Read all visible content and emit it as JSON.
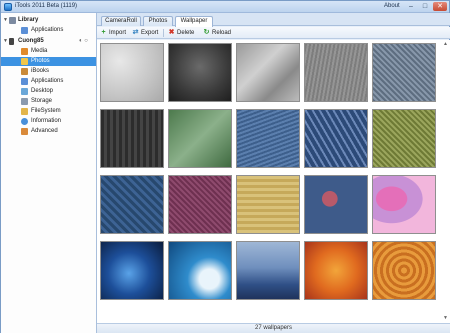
{
  "window": {
    "title": "iTools 2011 Beta (1119)",
    "about_label": "About",
    "min_glyph": "–",
    "max_glyph": "□",
    "close_glyph": "✕"
  },
  "sidebar": {
    "items": [
      {
        "label": "Library",
        "icon": "library-icon"
      },
      {
        "label": "Applications",
        "icon": "applications-icon"
      },
      {
        "label": "Cuong85",
        "icon": "iphone-icon",
        "controls": "◐ ○"
      },
      {
        "label": "Media",
        "icon": "media-icon"
      },
      {
        "label": "Photos",
        "icon": "photos-icon",
        "selected": true
      },
      {
        "label": "iBooks",
        "icon": "ibooks-icon"
      },
      {
        "label": "Applications",
        "icon": "applications-icon"
      },
      {
        "label": "Desktop",
        "icon": "desktop-icon"
      },
      {
        "label": "Storage",
        "icon": "storage-icon"
      },
      {
        "label": "FileSystem",
        "icon": "filesystem-icon"
      },
      {
        "label": "Information",
        "icon": "information-icon"
      },
      {
        "label": "Advanced",
        "icon": "advanced-icon"
      }
    ],
    "expand_glyph": "▼"
  },
  "tabs": [
    {
      "label": "CameraRoll"
    },
    {
      "label": "Photos"
    },
    {
      "label": "Wallpaper",
      "active": true
    }
  ],
  "toolbar": {
    "import_label": "Import",
    "export_label": "Export",
    "delete_label": "Delete",
    "reload_label": "Reload",
    "import_glyph": "+",
    "export_glyph": "⇄",
    "delete_glyph": "✖",
    "reload_glyph": "↻"
  },
  "wallpapers": [
    {
      "name": "gray-water-drops"
    },
    {
      "name": "dark-gray-grunge"
    },
    {
      "name": "gray-crumpled-fabric"
    },
    {
      "name": "gray-brushed-texture"
    },
    {
      "name": "blue-gray-knit"
    },
    {
      "name": "dark-stripes"
    },
    {
      "name": "green-canvas"
    },
    {
      "name": "blue-denim"
    },
    {
      "name": "blue-geometric-pattern"
    },
    {
      "name": "olive-dot-mesh"
    },
    {
      "name": "navy-weave"
    },
    {
      "name": "purple-dotted"
    },
    {
      "name": "yellow-woven"
    },
    {
      "name": "floral-blue-pattern"
    },
    {
      "name": "pink-camo"
    },
    {
      "name": "blue-bokeh"
    },
    {
      "name": "ocean-wave"
    },
    {
      "name": "misty-mountains"
    },
    {
      "name": "autumn-leaves"
    },
    {
      "name": "wood-rings"
    }
  ],
  "scroll": {
    "up_glyph": "▲",
    "down_glyph": "▼"
  },
  "status": {
    "count_text": "27 wallpapers"
  },
  "colors": {
    "selection": "#3c92e2",
    "accent": "#1e73c9"
  }
}
